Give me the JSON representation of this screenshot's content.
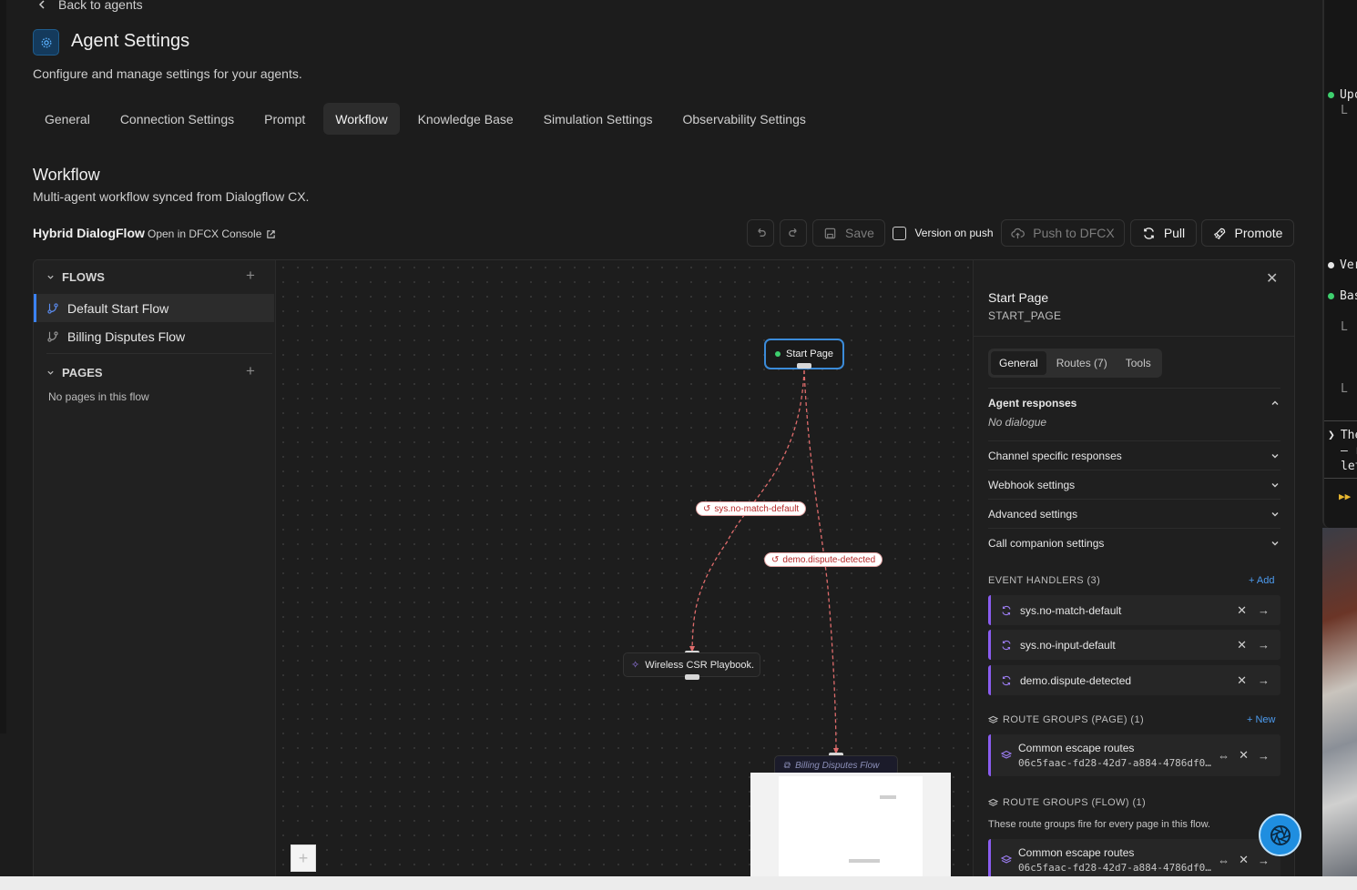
{
  "nav": {
    "back_label": "Back to agents"
  },
  "header": {
    "title": "Agent Settings",
    "subtitle": "Configure and manage settings for your agents."
  },
  "tabs": [
    {
      "label": "General"
    },
    {
      "label": "Connection Settings"
    },
    {
      "label": "Prompt"
    },
    {
      "label": "Workflow",
      "active": true
    },
    {
      "label": "Knowledge Base"
    },
    {
      "label": "Simulation Settings"
    },
    {
      "label": "Observability Settings"
    }
  ],
  "section": {
    "title": "Workflow",
    "subtitle": "Multi-agent workflow synced from Dialogflow CX."
  },
  "workflow": {
    "name": "Hybrid DialogFlow",
    "open_link": "Open in DFCX Console"
  },
  "toolbar": {
    "save": "Save",
    "version_on_push": "Version on push",
    "push": "Push to DFCX",
    "pull": "Pull",
    "promote": "Promote"
  },
  "sidebar": {
    "flows_header": "FLOWS",
    "flows": [
      {
        "label": "Default Start Flow",
        "active": true
      },
      {
        "label": "Billing Disputes Flow"
      }
    ],
    "pages_header": "PAGES",
    "pages_empty": "No pages in this flow"
  },
  "canvas": {
    "start_node": "Start Page",
    "edge_labels": [
      "sys.no-match-default",
      "demo.dispute-detected"
    ],
    "playbook_node": "Wireless CSR Playbook.",
    "flow_node": "Billing Disputes Flow"
  },
  "inspector": {
    "title": "Start Page",
    "subtitle": "START_PAGE",
    "tabs": [
      "General",
      "Routes (7)",
      "Tools"
    ],
    "agent_responses": "Agent responses",
    "no_dialogue": "No dialogue",
    "sections": [
      "Channel specific responses",
      "Webhook settings",
      "Advanced settings",
      "Call companion settings"
    ],
    "event_handlers_header": "EVENT HANDLERS (3)",
    "add_label": "+ Add",
    "event_handlers": [
      "sys.no-match-default",
      "sys.no-input-default",
      "demo.dispute-detected"
    ],
    "route_groups_page_header": "ROUTE GROUPS (PAGE) (1)",
    "new_label": "+ New",
    "route_groups_page": [
      {
        "name": "Common escape routes",
        "id": "06c5faac-fd28-42d7-a884-4786df0…"
      }
    ],
    "route_groups_flow_header": "ROUTE GROUPS (FLOW) (1)",
    "route_groups_flow_note": "These route groups fire for every page in this flow.",
    "route_groups_flow": [
      {
        "name": "Common escape routes",
        "id": "06c5faac-fd28-42d7-a884-4786df0…"
      }
    ]
  },
  "side_window": {
    "lines": [
      "Upc",
      "L",
      "Ver",
      "Bas",
      "L",
      "L",
      "The",
      "– r",
      "let"
    ]
  },
  "colors": {
    "accent": "#3b82f6",
    "event_accent": "#8a5cf0",
    "edge": "#e06c6c",
    "status_green": "#3ecf6e"
  }
}
